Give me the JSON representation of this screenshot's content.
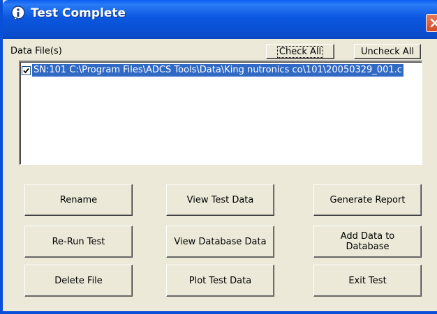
{
  "window": {
    "title": "Test Complete"
  },
  "data_files": {
    "label": "Data File(s)",
    "check_all": "Check All",
    "uncheck_all": "Uncheck All",
    "items": [
      {
        "checked": true,
        "text": "SN:101 C:\\Program Files\\ADCS Tools\\Data\\King nutronics co\\101\\20050329_001.c"
      }
    ]
  },
  "buttons": {
    "rename": "Rename",
    "view_test_data": "View Test Data",
    "generate_report": "Generate Report",
    "rerun_test": "Re-Run Test",
    "view_database_data": "View Database Data",
    "add_data_line1": "Add Data to",
    "add_data_line2": "Database",
    "delete_file": "Delete File",
    "plot_test_data": "Plot Test Data",
    "exit_test": "Exit Test"
  }
}
